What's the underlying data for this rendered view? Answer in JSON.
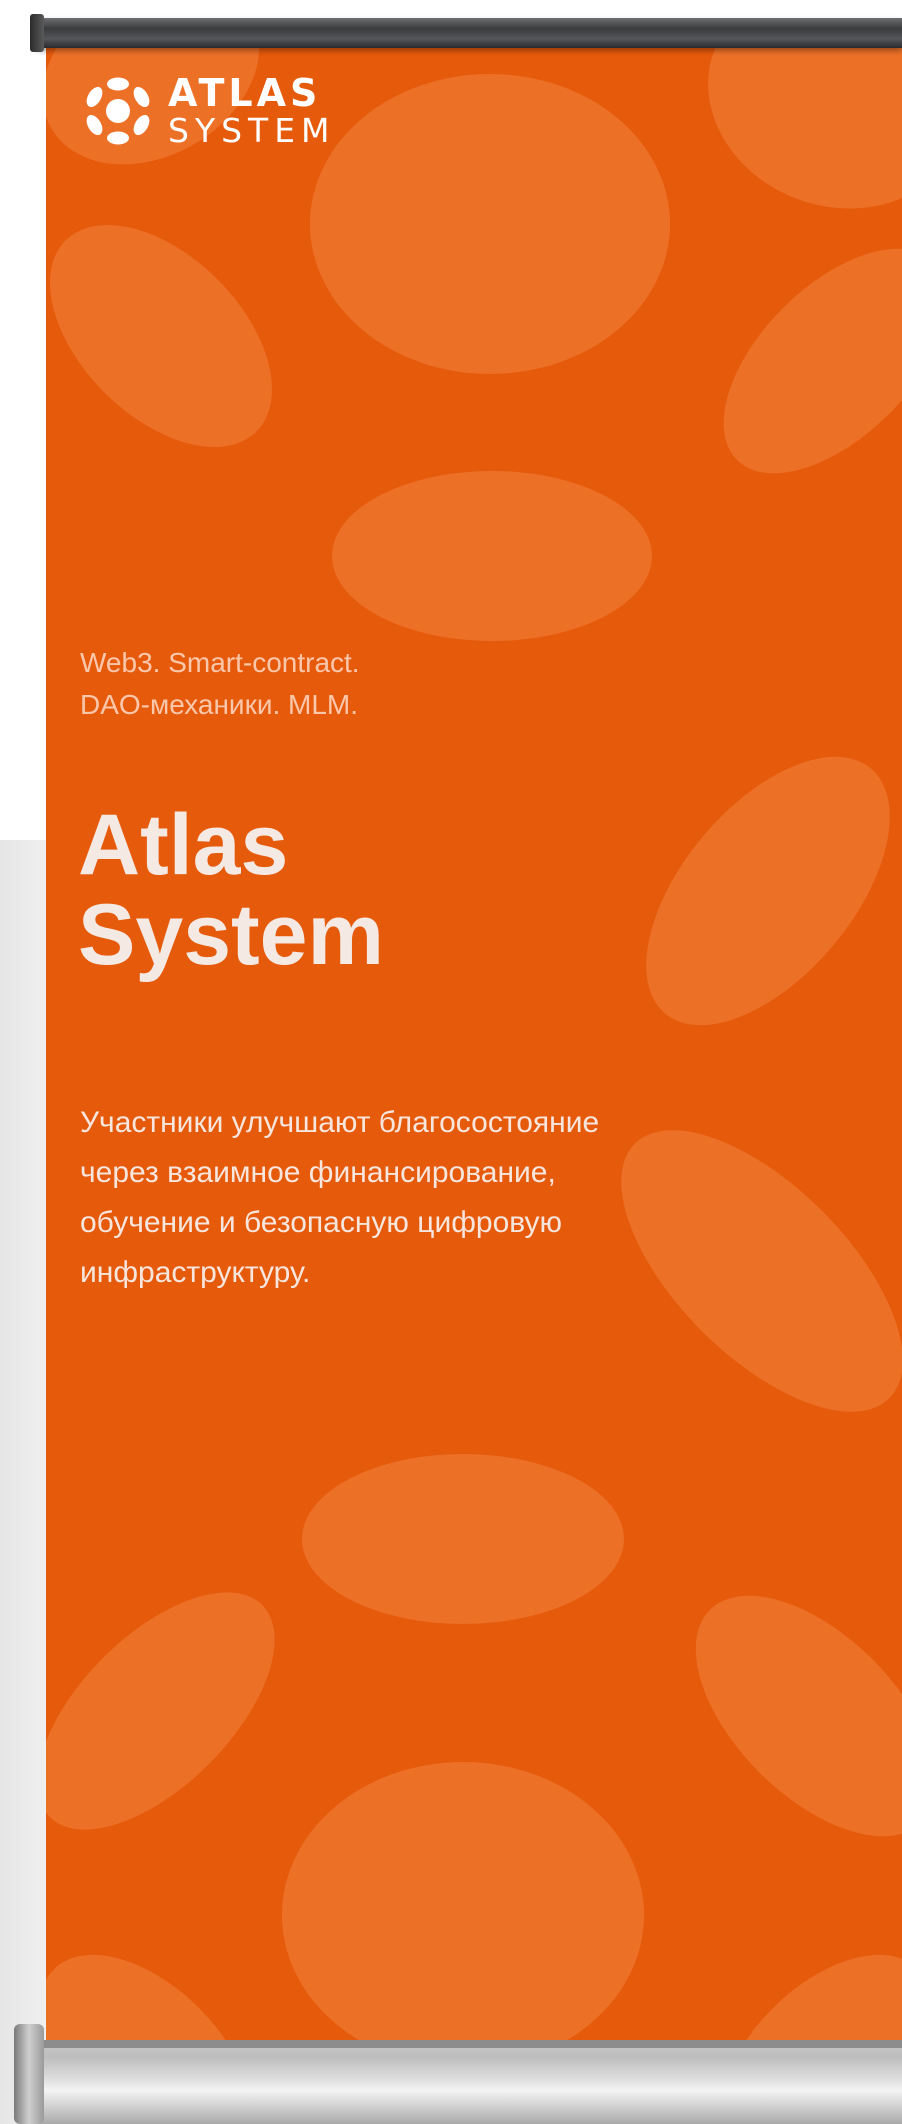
{
  "logo": {
    "line1": "ATLAS",
    "line2": "SYSTEM",
    "icon": "atlas-dots-logo-icon"
  },
  "tagline": {
    "line1": "Web3. Smart-contract.",
    "line2": "DAO-механики. MLM."
  },
  "title": {
    "line1": "Atlas",
    "line2": "System"
  },
  "description": {
    "lines": [
      "Участники улучшают благосостояние",
      "через взаимное финансирование,",
      "обучение и безопасную цифровую",
      "инфраструктуру."
    ]
  },
  "colors": {
    "banner": "#e65a0c",
    "blob": "rgba(255,170,110,0.28)",
    "text": "#f4e9e3"
  }
}
